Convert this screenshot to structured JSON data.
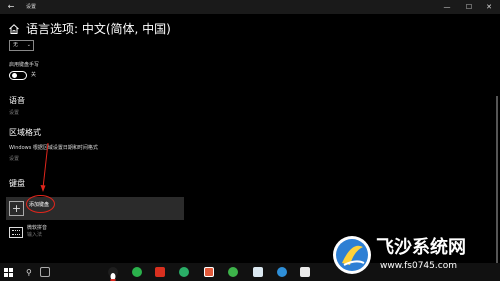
{
  "window": {
    "title": "设置",
    "back_glyph": "←",
    "min_glyph": "—",
    "max_glyph": "☐",
    "close_glyph": "✕"
  },
  "page": {
    "title": "语言选项: 中文(简体, 中国)"
  },
  "handwriting": {
    "select_value": "无",
    "label": "启用键盘手写",
    "toggle_state": "关",
    "toggle_on": false
  },
  "sections": {
    "voice": {
      "title": "语音",
      "sub": "设置"
    },
    "regional": {
      "title": "区域格式",
      "desc": "Windows 根据区域设置日期和时间格式",
      "sub": "设置"
    },
    "keyboard": {
      "title": "键盘"
    }
  },
  "add_keyboard": {
    "label": "添加键盘",
    "glyph": "+"
  },
  "keyboards": [
    {
      "name": "微软拼音",
      "type": "输入法"
    }
  ],
  "taskbar": {
    "search_glyph": "⚲",
    "apps": [
      "qq",
      "360",
      "pdf",
      "wechat",
      "reader",
      "security",
      "game",
      "bird",
      "qq2",
      "hw"
    ]
  },
  "watermark": {
    "text": "飞沙系统网",
    "url": "www.fs0745.com"
  },
  "colors": {
    "accent_red": "#e1261c",
    "background": "#000000",
    "item_bg": "#2b2b2b"
  }
}
